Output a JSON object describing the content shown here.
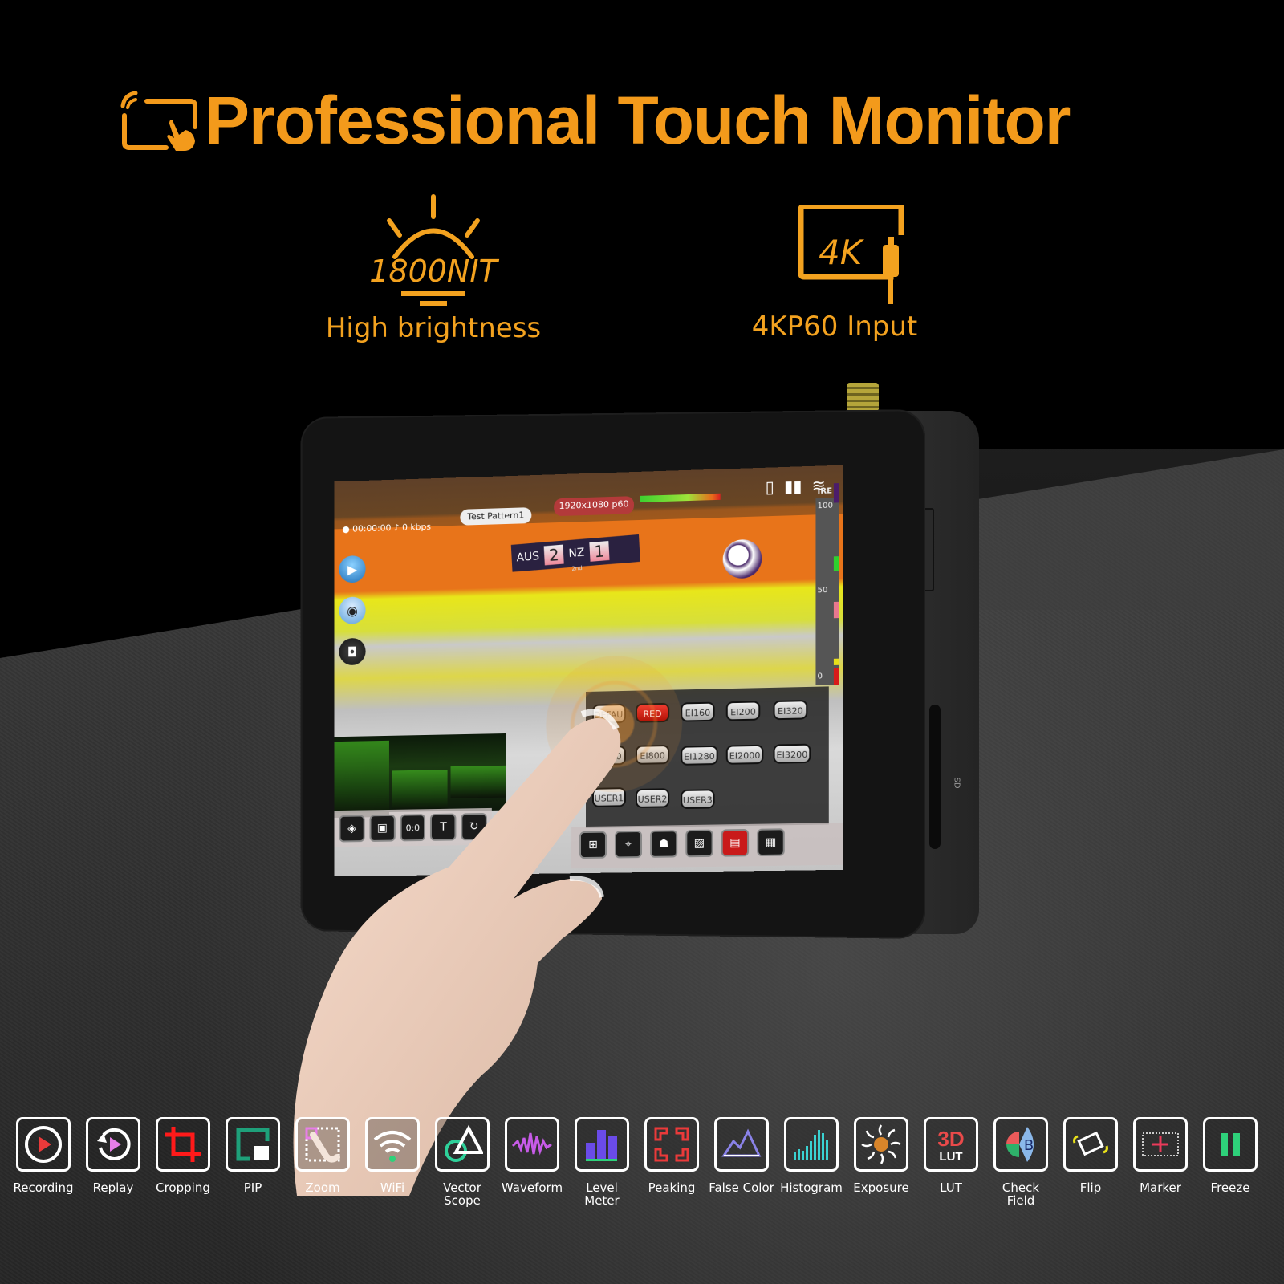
{
  "header": {
    "title": "Professional Touch Monitor",
    "title_icon": "touch-screen-icon",
    "accent_color": "#f39a1b"
  },
  "highlights": [
    {
      "icon": "brightness-sun-icon",
      "icon_text": "1800NIT",
      "label": "High brightness"
    },
    {
      "icon": "4k-input-icon",
      "icon_text": "4K",
      "label": "4KP60 Input"
    }
  ],
  "monitor_screen": {
    "record_time": "00:00:00",
    "bitrate": "0 kbps",
    "source": "Test Pattern1",
    "resolution": "1920x1080 p60",
    "scoreboard": {
      "team1": "AUS",
      "score1": "2",
      "team2": "NZ",
      "score2": "1",
      "period": "2nd"
    },
    "ire_scale": {
      "title": "IRE",
      "ticks": [
        "100",
        "50",
        "0"
      ]
    },
    "iso_menu": {
      "rows": [
        [
          "DEFAULT",
          "RED",
          "EI160",
          "EI200",
          "EI320"
        ],
        [
          "EI500",
          "EI800",
          "EI1280",
          "EI2000",
          "EI3200"
        ],
        [
          "USER1",
          "USER2",
          "USER3"
        ]
      ],
      "active": "RED"
    },
    "left_toolbar": [
      "layers-icon",
      "folder-icon",
      "0:0",
      "text-icon",
      "rotate-icon"
    ],
    "right_toolbar": [
      "image-add-icon",
      "crosshair-icon",
      "portrait-icon",
      "zebra-icon",
      "false-color-icon",
      "settings-panel-icon"
    ],
    "side_buttons": [
      "play-icon",
      "wireless-icon",
      "camera-icon"
    ]
  },
  "device": {
    "sd_label": "SD"
  },
  "features": [
    {
      "label": "Recording",
      "icon": "record-icon"
    },
    {
      "label": "Replay",
      "icon": "replay-icon"
    },
    {
      "label": "Cropping",
      "icon": "crop-icon"
    },
    {
      "label": "PIP",
      "icon": "pip-icon"
    },
    {
      "label": "Zoom",
      "icon": "zoom-touch-icon"
    },
    {
      "label": "WiFi",
      "icon": "wifi-icon"
    },
    {
      "label": "Vector Scope",
      "icon": "vector-scope-icon"
    },
    {
      "label": "Waveform",
      "icon": "waveform-icon"
    },
    {
      "label": "Level Meter",
      "icon": "level-meter-icon"
    },
    {
      "label": "Peaking",
      "icon": "peaking-icon"
    },
    {
      "label": "False Color",
      "icon": "false-color-icon"
    },
    {
      "label": "Histogram",
      "icon": "histogram-icon"
    },
    {
      "label": "Exposure",
      "icon": "exposure-icon"
    },
    {
      "label": "LUT",
      "icon": "3d-lut-icon",
      "icon_text": "3D"
    },
    {
      "label": "Check Field",
      "icon": "check-field-icon"
    },
    {
      "label": "Flip",
      "icon": "flip-icon"
    },
    {
      "label": "Marker",
      "icon": "marker-icon"
    },
    {
      "label": "Freeze",
      "icon": "freeze-icon"
    }
  ]
}
